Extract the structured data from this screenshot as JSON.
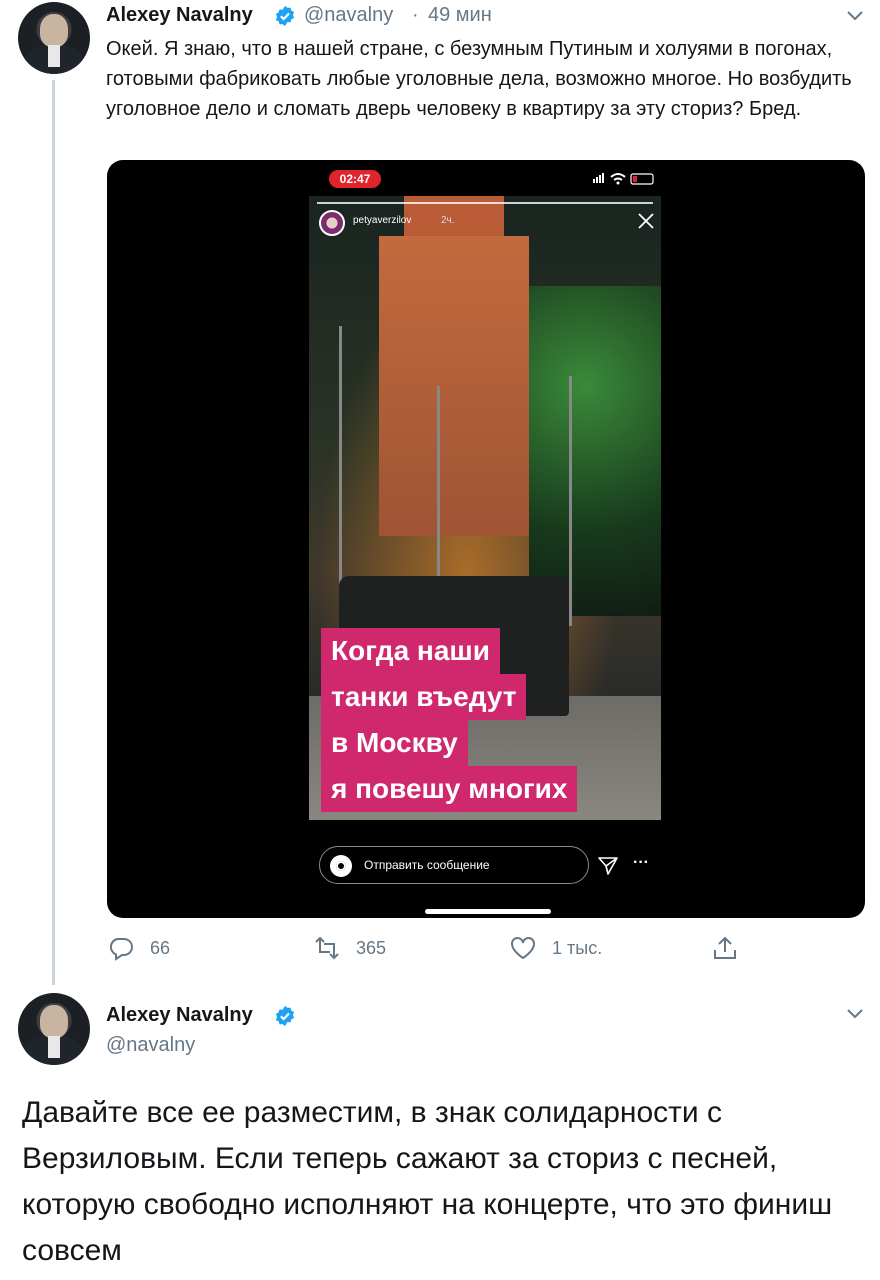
{
  "tweet1": {
    "author_name": "Alexey Navalny",
    "handle": "@navalny",
    "separator": "·",
    "time": "49 мин",
    "text": "Окей. Я знаю, что в нашей стране, с безумным Путиным и холуями в погонах, готовыми фабриковать любые уголовные дела, возможно многое. Но возбудить уголовное дело и сломать дверь человеку в квартиру за эту сториз? Бред.",
    "media": {
      "phone_time": "02:47",
      "story_user": "petyaverzilov",
      "story_age": "2ч.",
      "caption_lines": [
        "Когда наши",
        "танки въедут",
        "в Москву",
        "я повешу многих"
      ],
      "message_placeholder": "Отправить сообщение",
      "more_glyph": "···"
    },
    "actions": {
      "replies": "66",
      "retweets": "365",
      "likes": "1 тыс."
    }
  },
  "tweet2": {
    "author_name": "Alexey Navalny",
    "handle": "@navalny",
    "text": "Давайте все ее разместим, в знак солидарности с Верзиловым. Если теперь сажают за сториз с песней, которую свободно исполняют на концерте, что это финиш совсем"
  },
  "colors": {
    "verified": "#1da1f2",
    "secondary_text": "#657786",
    "thread_line": "#ccd6dd",
    "caption_bg": "#d0286c",
    "time_pill": "#e0242c"
  },
  "icons": [
    "verified-badge-icon",
    "chevron-down-icon",
    "reply-icon",
    "retweet-icon",
    "like-icon",
    "share-icon",
    "camera-icon",
    "send-icon",
    "close-icon"
  ]
}
